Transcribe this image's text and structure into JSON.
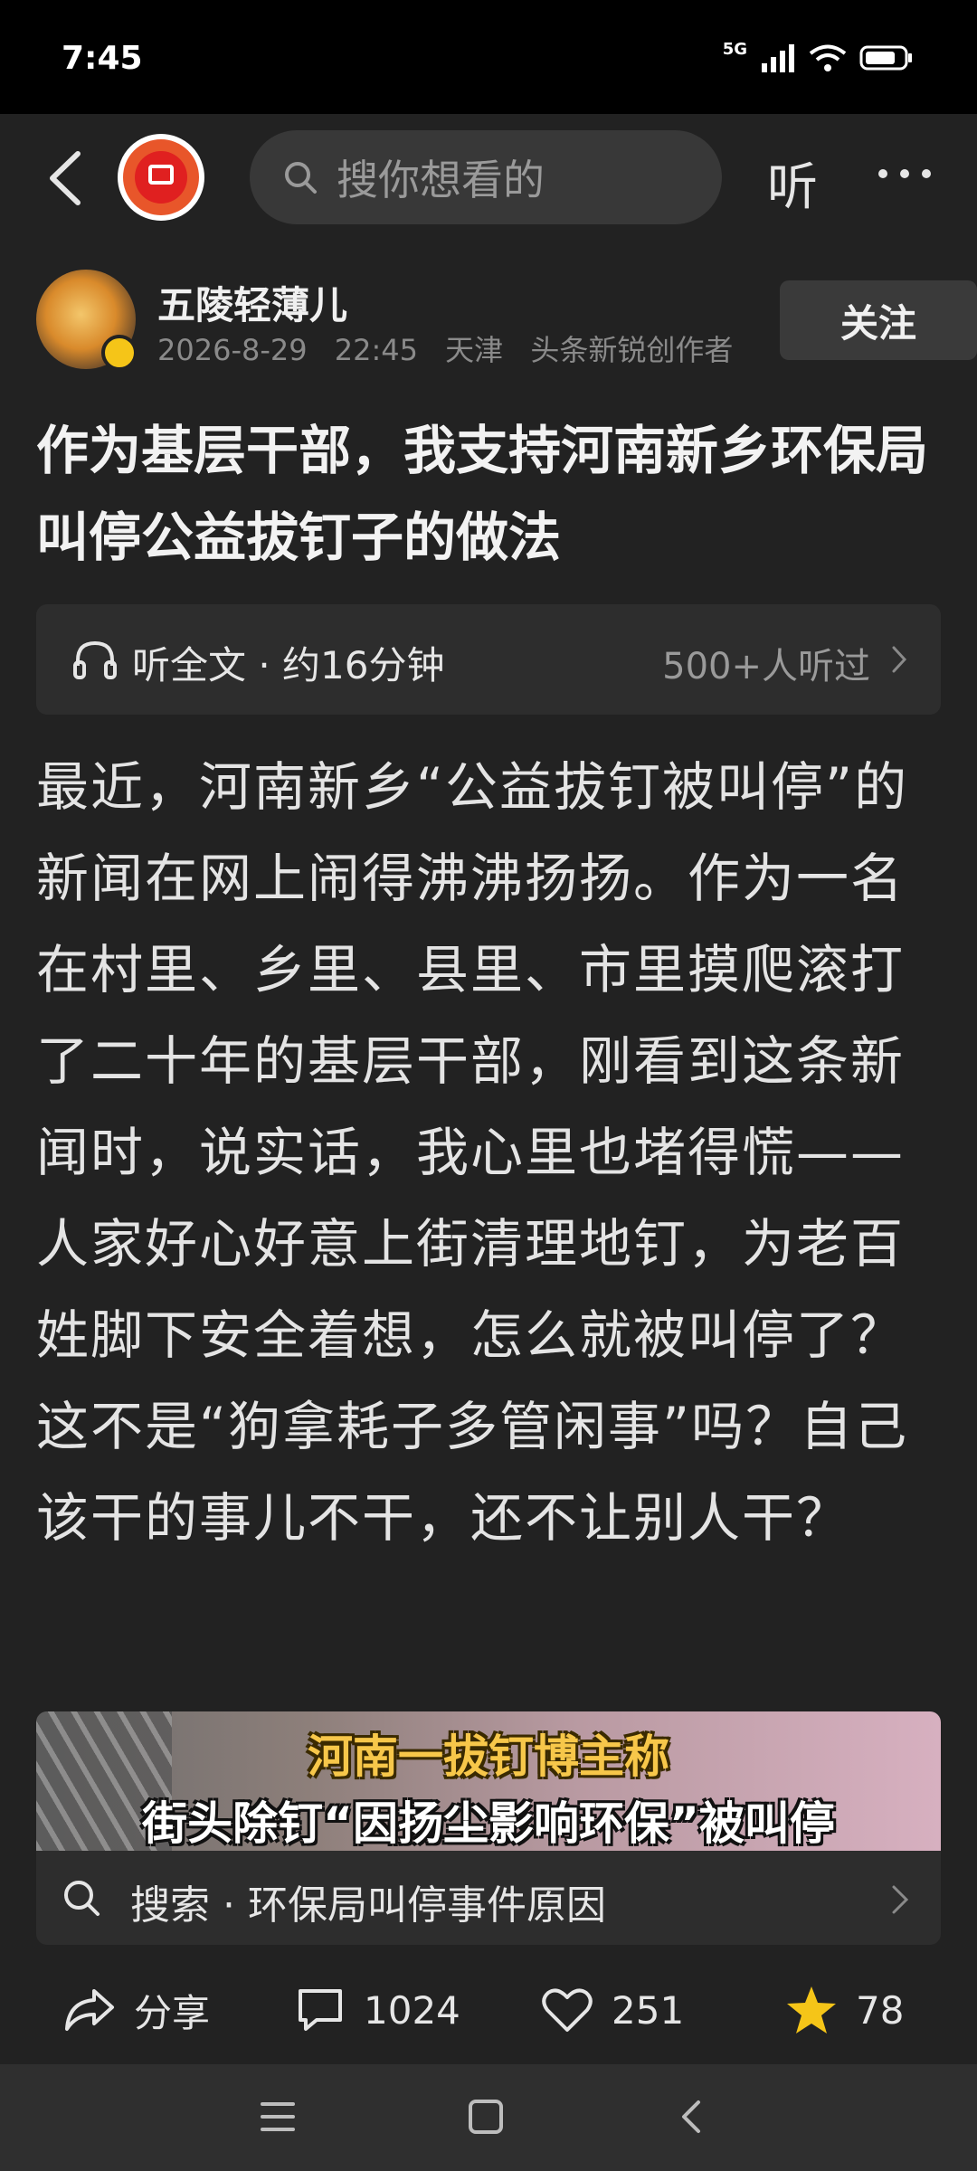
{
  "status_bar": {
    "time": "7:45",
    "network": "5G",
    "icons": [
      "signal-icon",
      "wifi-icon",
      "battery-icon"
    ]
  },
  "top_bar": {
    "search_placeholder": "搜你想看的",
    "listen_label": "听",
    "icons": [
      "back-icon",
      "app-logo-icon",
      "search-icon",
      "more-icon"
    ]
  },
  "author": {
    "name": "五陵轻薄儿",
    "date": "2026-8-29",
    "time": "22:45",
    "location": "天津",
    "title": "头条新锐创作者",
    "follow_label": "关注"
  },
  "article": {
    "title": "作为基层干部，我支持河南新乡环保局叫停公益拔钉子的做法",
    "listen_full": "听全文 · 约16分钟",
    "listen_count": "500+人听过",
    "body": "最近，河南新乡“公益拔钉被叫停”的新闻在网上闹得沸沸扬扬。作为一名在村里、乡里、县里、市里摸爬滚打了二十年的基层干部，刚看到这条新闻时，说实话，我心里也堵得慌——人家好心好意上街清理地钉，为老百姓脚下安全着想，怎么就被叫停了？这不是“狗拿耗子多管闲事”吗？自己该干的事儿不干，还不让别人干？"
  },
  "video": {
    "caption_line1": "河南一拔钉博主称",
    "caption_line2": "街头除钉“因扬尘影响环保”被叫停"
  },
  "search_suggest": {
    "label": "搜索 · 环保局叫停事件原因"
  },
  "actions": {
    "share_label": "分享",
    "comment_count": "1024",
    "like_count": "251",
    "favorite_count": "78"
  },
  "colors": {
    "background": "#222222",
    "favorite_star": "#f5c518",
    "logo_orange": "#e8562a"
  }
}
